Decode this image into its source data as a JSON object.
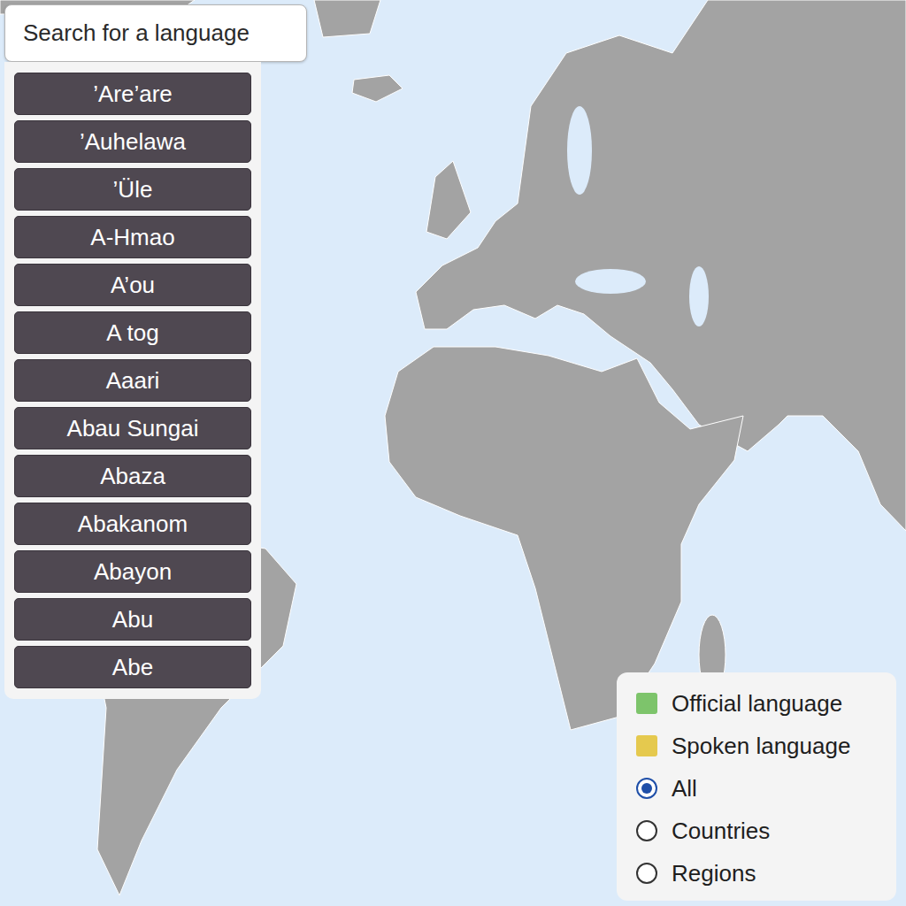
{
  "search": {
    "placeholder": "Search for a language"
  },
  "languages": [
    "’Are’are",
    "’Auhelawa",
    "’Üle",
    "A-Hmao",
    "A’ou",
    "A tog",
    "Aaari",
    "Abau Sungai",
    "Abaza",
    "Abakanom",
    "Abayon",
    "Abu",
    "Abe"
  ],
  "legend": [
    {
      "label": "Official language",
      "color": "#7dc46b"
    },
    {
      "label": "Spoken language",
      "color": "#e5c94e"
    }
  ],
  "filters": [
    {
      "label": "All",
      "selected": true
    },
    {
      "label": "Countries",
      "selected": false
    },
    {
      "label": "Regions",
      "selected": false
    }
  ]
}
